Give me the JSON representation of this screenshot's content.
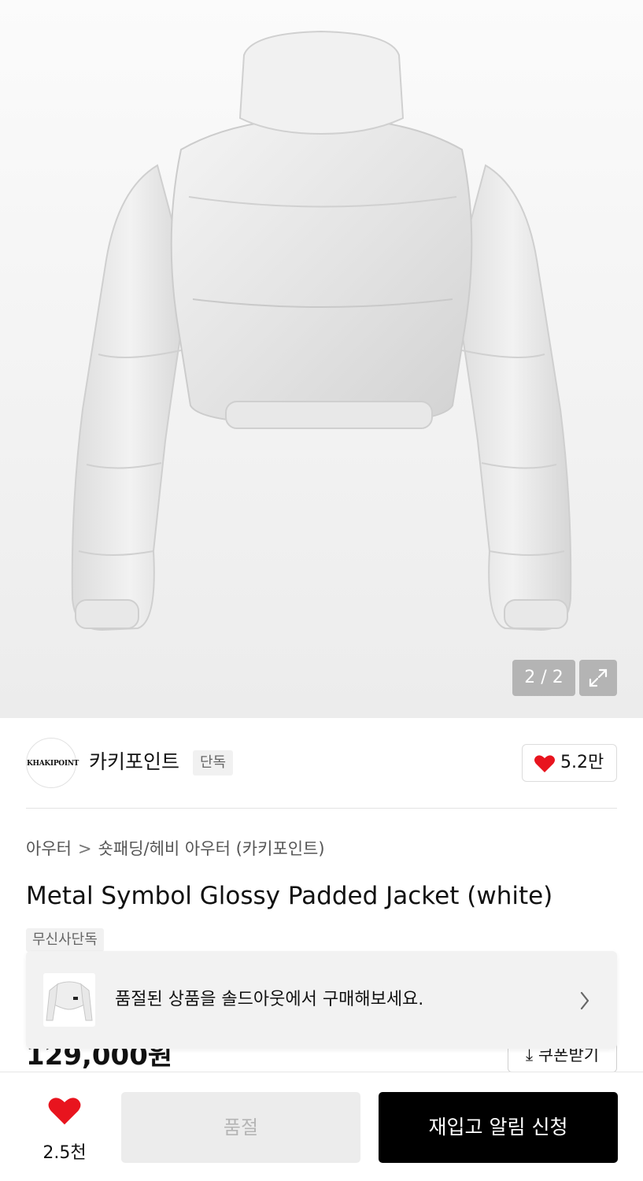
{
  "gallery": {
    "counter": "2 / 2",
    "image_alt": "white cropped glossy padded jacket, back view"
  },
  "brand": {
    "logo_text": "KHAKIPOINT",
    "name": "카키포인트",
    "tag": "단독",
    "like_count": "5.2만"
  },
  "breadcrumb": {
    "level1": "아우터",
    "separator": ">",
    "level2": "숏패딩/헤비 아우터 (카키포인트)"
  },
  "product": {
    "title": "Metal Symbol Glossy Padded Jacket (white)",
    "exclusive_badge": "무신사단독",
    "price": "129,000원",
    "coupon_label": "⤓ 쿠폰받기"
  },
  "banner": {
    "message": "품절된 상품을 솔드아웃에서 구매해보세요."
  },
  "bottom_bar": {
    "fav_count": "2.5천",
    "soldout_label": "품절",
    "restock_label": "재입고 알림 신청"
  },
  "colors": {
    "heart": "#e8141e",
    "primary_button": "#000000",
    "disabled_button": "#ececec"
  }
}
